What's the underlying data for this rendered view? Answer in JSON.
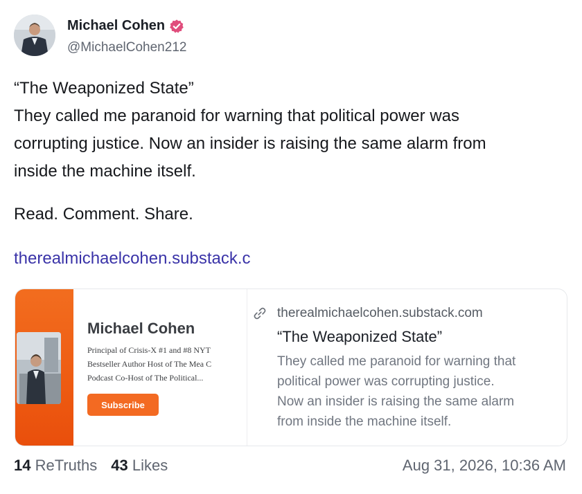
{
  "author": {
    "display_name": "Michael Cohen",
    "handle": "@MichaelCohen212",
    "verified_color": "#e04d7c"
  },
  "post": {
    "lines": [
      "“The Weaponized State”",
      "They called me paranoid for warning that political power was",
      "corrupting justice. Now an insider is raising the same alarm from",
      "inside the machine itself."
    ],
    "cta": "Read. Comment. Share.",
    "link_text": "therealmichaelcohen.substack.c"
  },
  "card": {
    "thumb": {
      "title": "Michael Cohen",
      "desc_lines": [
        "Principal of Crisis-X #1 and #8 NYT",
        "Bestseller Author Host of The Mea C",
        "Podcast Co-Host of The Political..."
      ],
      "subscribe_label": "Subscribe",
      "accent_color": "#f26d1f"
    },
    "domain": "therealmichaelcohen.substack.com",
    "title": "“The Weaponized State”",
    "desc_lines": [
      "They called me paranoid for warning that",
      "political power was corrupting justice.",
      "Now an insider is raising the same alarm",
      "from inside the machine itself."
    ],
    "link_icon": "link-icon"
  },
  "footer": {
    "retruths_count": "14",
    "retruths_label": "ReTruths",
    "likes_count": "43",
    "likes_label": "Likes",
    "timestamp": "Aug 31, 2026, 10:36 AM"
  }
}
